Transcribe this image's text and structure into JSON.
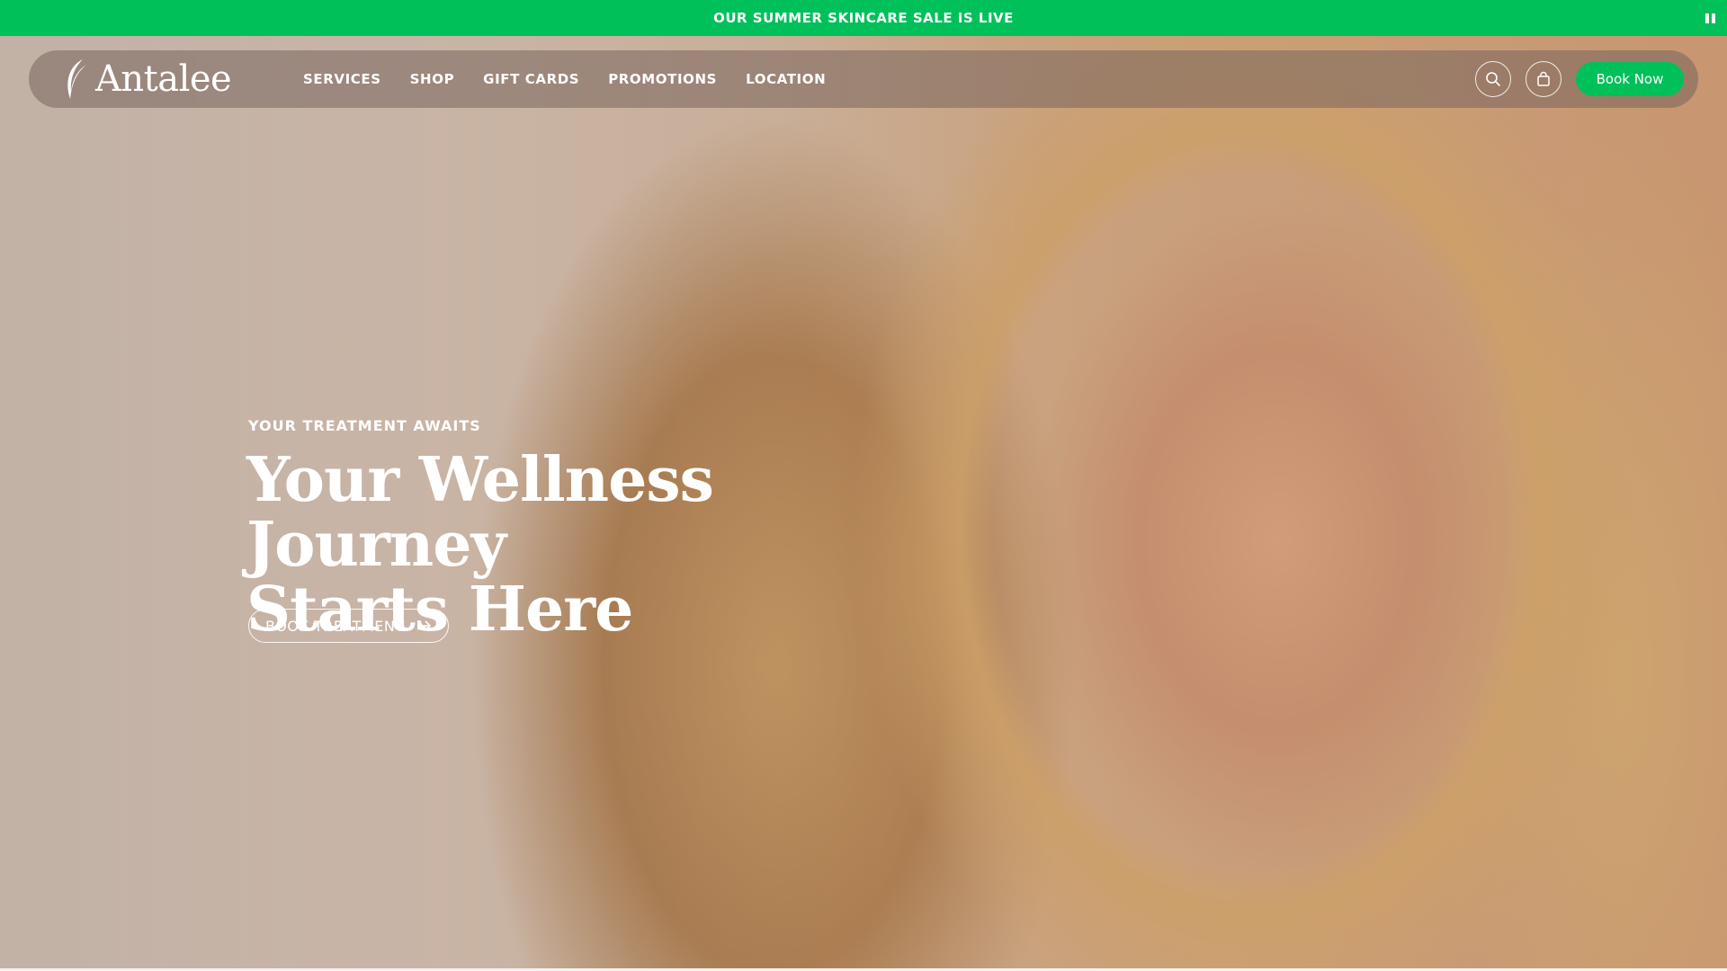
{
  "announcement": {
    "text": "OUR SUMMER SKINCARE SALE IS LIVE",
    "pause_icon": "pause-icon"
  },
  "header": {
    "logo_text": "Antalee",
    "nav": [
      {
        "label": "SERVICES"
      },
      {
        "label": "SHOP"
      },
      {
        "label": "GIFT CARDS"
      },
      {
        "label": "PROMOTIONS"
      },
      {
        "label": "LOCATION"
      }
    ],
    "search_icon": "search-icon",
    "bag_icon": "shopping-bag-icon",
    "book_now_label": "Book Now"
  },
  "hero": {
    "eyebrow": "YOUR TREATMENT AWAITS",
    "title_line1": "Your Wellness Journey",
    "title_line2": "Starts Here",
    "cta_label": "BOOK TREATMENT",
    "cta_icon": "arrow-right-icon"
  },
  "colors": {
    "brand_green": "#00c05a",
    "header_overlay": "#78645c"
  }
}
